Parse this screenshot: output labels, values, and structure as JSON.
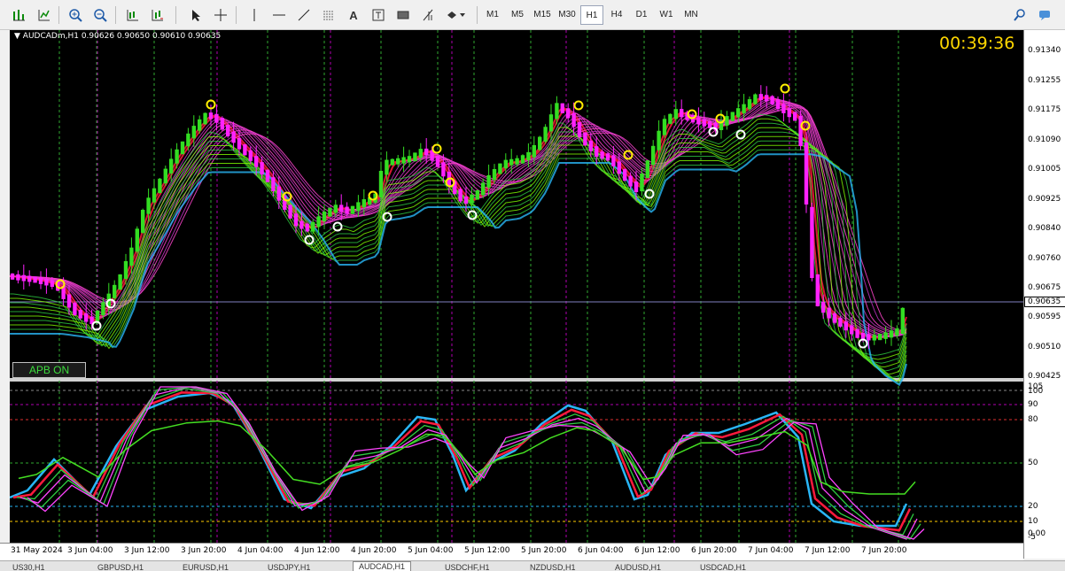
{
  "toolbar": {
    "timeframes": [
      "M1",
      "M5",
      "M15",
      "M30",
      "H1",
      "H4",
      "D1",
      "W1",
      "MN"
    ],
    "active_timeframe": "H1",
    "text_tool_label": "A"
  },
  "chart": {
    "symbol_info": "AUDCADm,H1  0.90626 0.90650 0.90610 0.90635",
    "countdown": "00:39:36",
    "apb_button": "APB ON",
    "current_price": "0.90635",
    "price_labels": [
      "0.91340",
      "0.91255",
      "0.91175",
      "0.91090",
      "0.91005",
      "0.90925",
      "0.90840",
      "0.90760",
      "0.90675",
      "0.90595",
      "0.90510",
      "0.90425"
    ],
    "oscillator_labels": [
      "105",
      "100",
      "90",
      "80",
      "50",
      "20",
      "10",
      "0.00",
      "-5"
    ],
    "time_labels": [
      "31 May 2024",
      "3 Jun 04:00",
      "3 Jun 12:00",
      "3 Jun 20:00",
      "4 Jun 04:00",
      "4 Jun 12:00",
      "4 Jun 20:00",
      "5 Jun 04:00",
      "5 Jun 12:00",
      "5 Jun 20:00",
      "6 Jun 04:00",
      "6 Jun 12:00",
      "6 Jun 20:00",
      "7 Jun 04:00",
      "7 Jun 12:00",
      "7 Jun 20:00"
    ],
    "colors": {
      "background": "#000000",
      "bull_candle": "#33dd22",
      "bear_candle": "#ff22ff",
      "ribbon_up": "#2ecc40",
      "ribbon_down": "#ff1a3c",
      "line_blue": "#29b6f6",
      "grid_green": "#2fa82f",
      "grid_magenta": "#b000b0",
      "timer": "#ffd700"
    }
  },
  "tabs": [
    "US30,H1",
    "GBPUSD,H1",
    "EURUSD,H1",
    "USDJPY,H1",
    "AUDCAD,H1",
    "USDCHF,H1",
    "NZDUSD,H1",
    "AUDUSD,H1",
    "USDCAD,H1"
  ],
  "active_tab": "AUDCAD,H1"
}
